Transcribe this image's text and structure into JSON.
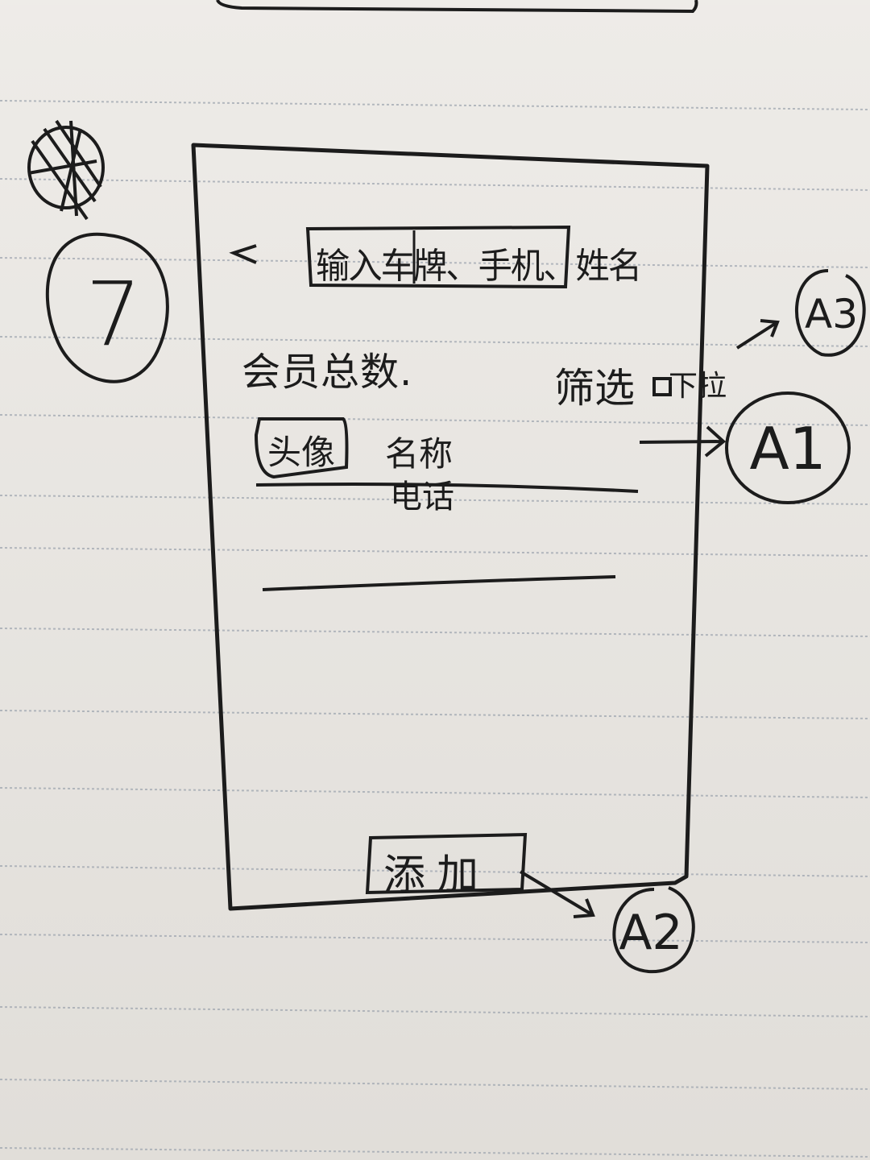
{
  "screen_number": "7",
  "header": {
    "back_icon": "chevron-left-icon",
    "search_placeholder": "输入车牌、手机、姓名"
  },
  "summary": {
    "total_label": "会员总数."
  },
  "filter": {
    "dropdown_label": "筛选",
    "dropdown_icon": "checkbox-square-icon",
    "dropdown_suffix": "下拉"
  },
  "member_row": {
    "avatar_label": "头像",
    "name_label": "名称",
    "phone_label": "电话"
  },
  "footer": {
    "add_button": "添加"
  },
  "annotations": {
    "a1": "A1",
    "a2": "A2",
    "a3": "A3"
  }
}
